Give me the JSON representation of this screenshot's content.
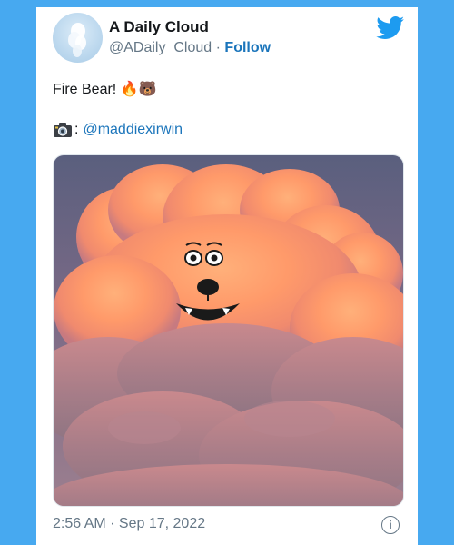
{
  "author": {
    "name": "A Daily Cloud",
    "handle": "@ADaily_Cloud",
    "separator": "·",
    "follow_label": "Follow"
  },
  "tweet": {
    "text": "Fire Bear!",
    "emojis": "🔥🐻",
    "credit_suffix": ":",
    "credit_mention": "@maddiexirwin"
  },
  "photo": {
    "icon": "cloud-bear-photo"
  },
  "footer": {
    "timestamp": "2:56 AM · Sep 17, 2022",
    "info_icon": "i"
  },
  "colors": {
    "background": "#47a9f0",
    "link": "#1b75bb",
    "twitter_blue": "#1d9bf0",
    "muted_text": "#657786"
  }
}
